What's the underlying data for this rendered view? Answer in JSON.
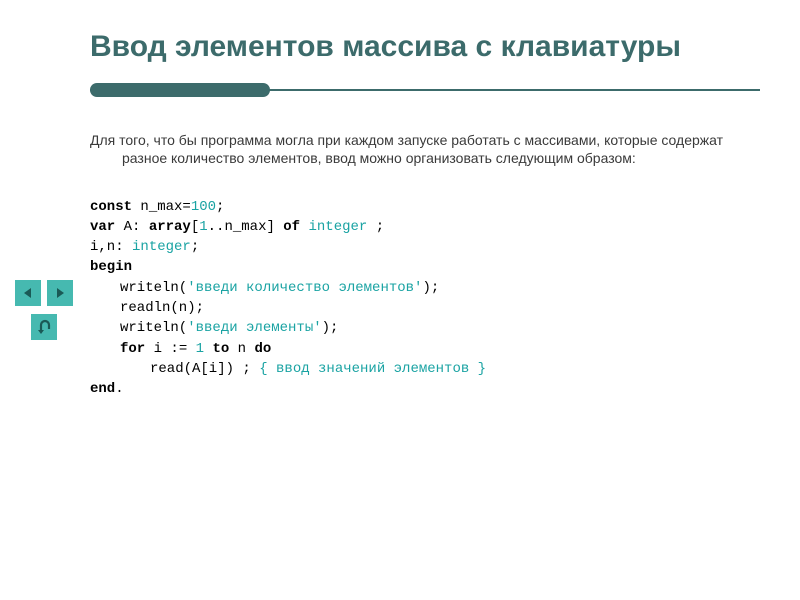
{
  "title": "Ввод элементов массива с клавиатуры",
  "intro": "Для того, что бы программа могла при каждом запуске работать с массивами, которые содержат разное количество элементов, ввод можно организовать следующим образом:",
  "code": {
    "l1_kw": "const",
    "l1_rest": " n_max=",
    "l1_num": "100",
    "l1_end": ";",
    "l2_kw": "var",
    "l2_a": " A: ",
    "l2_arr": "array",
    "l2_b": "[",
    "l2_n1": "1",
    "l2_c": "..n_max] ",
    "l2_of": "of",
    "l2_sp": " ",
    "l2_type": "integer",
    "l2_end": " ;",
    "l3_a": "i,n: ",
    "l3_type": "integer",
    "l3_end": ";",
    "l4_kw": "begin",
    "l5_a": "writeln(",
    "l5_str": "'введи количество элементов'",
    "l5_b": ");",
    "l6": "readln(n);",
    "l7_a": "writeln(",
    "l7_str": "'введи элементы'",
    "l7_b": ");",
    "l8_for": "for",
    "l8_a": " i := ",
    "l8_n1": "1",
    "l8_sp": " ",
    "l8_to": "to",
    "l8_b": " n ",
    "l8_do": "do",
    "l9_a": "read(A[i]) ; ",
    "l9_comment": "{ ввод значений элементов }",
    "l10_kw": "end",
    "l10_end": "."
  },
  "nav": {
    "prev": "previous",
    "next": "next",
    "home": "home"
  }
}
